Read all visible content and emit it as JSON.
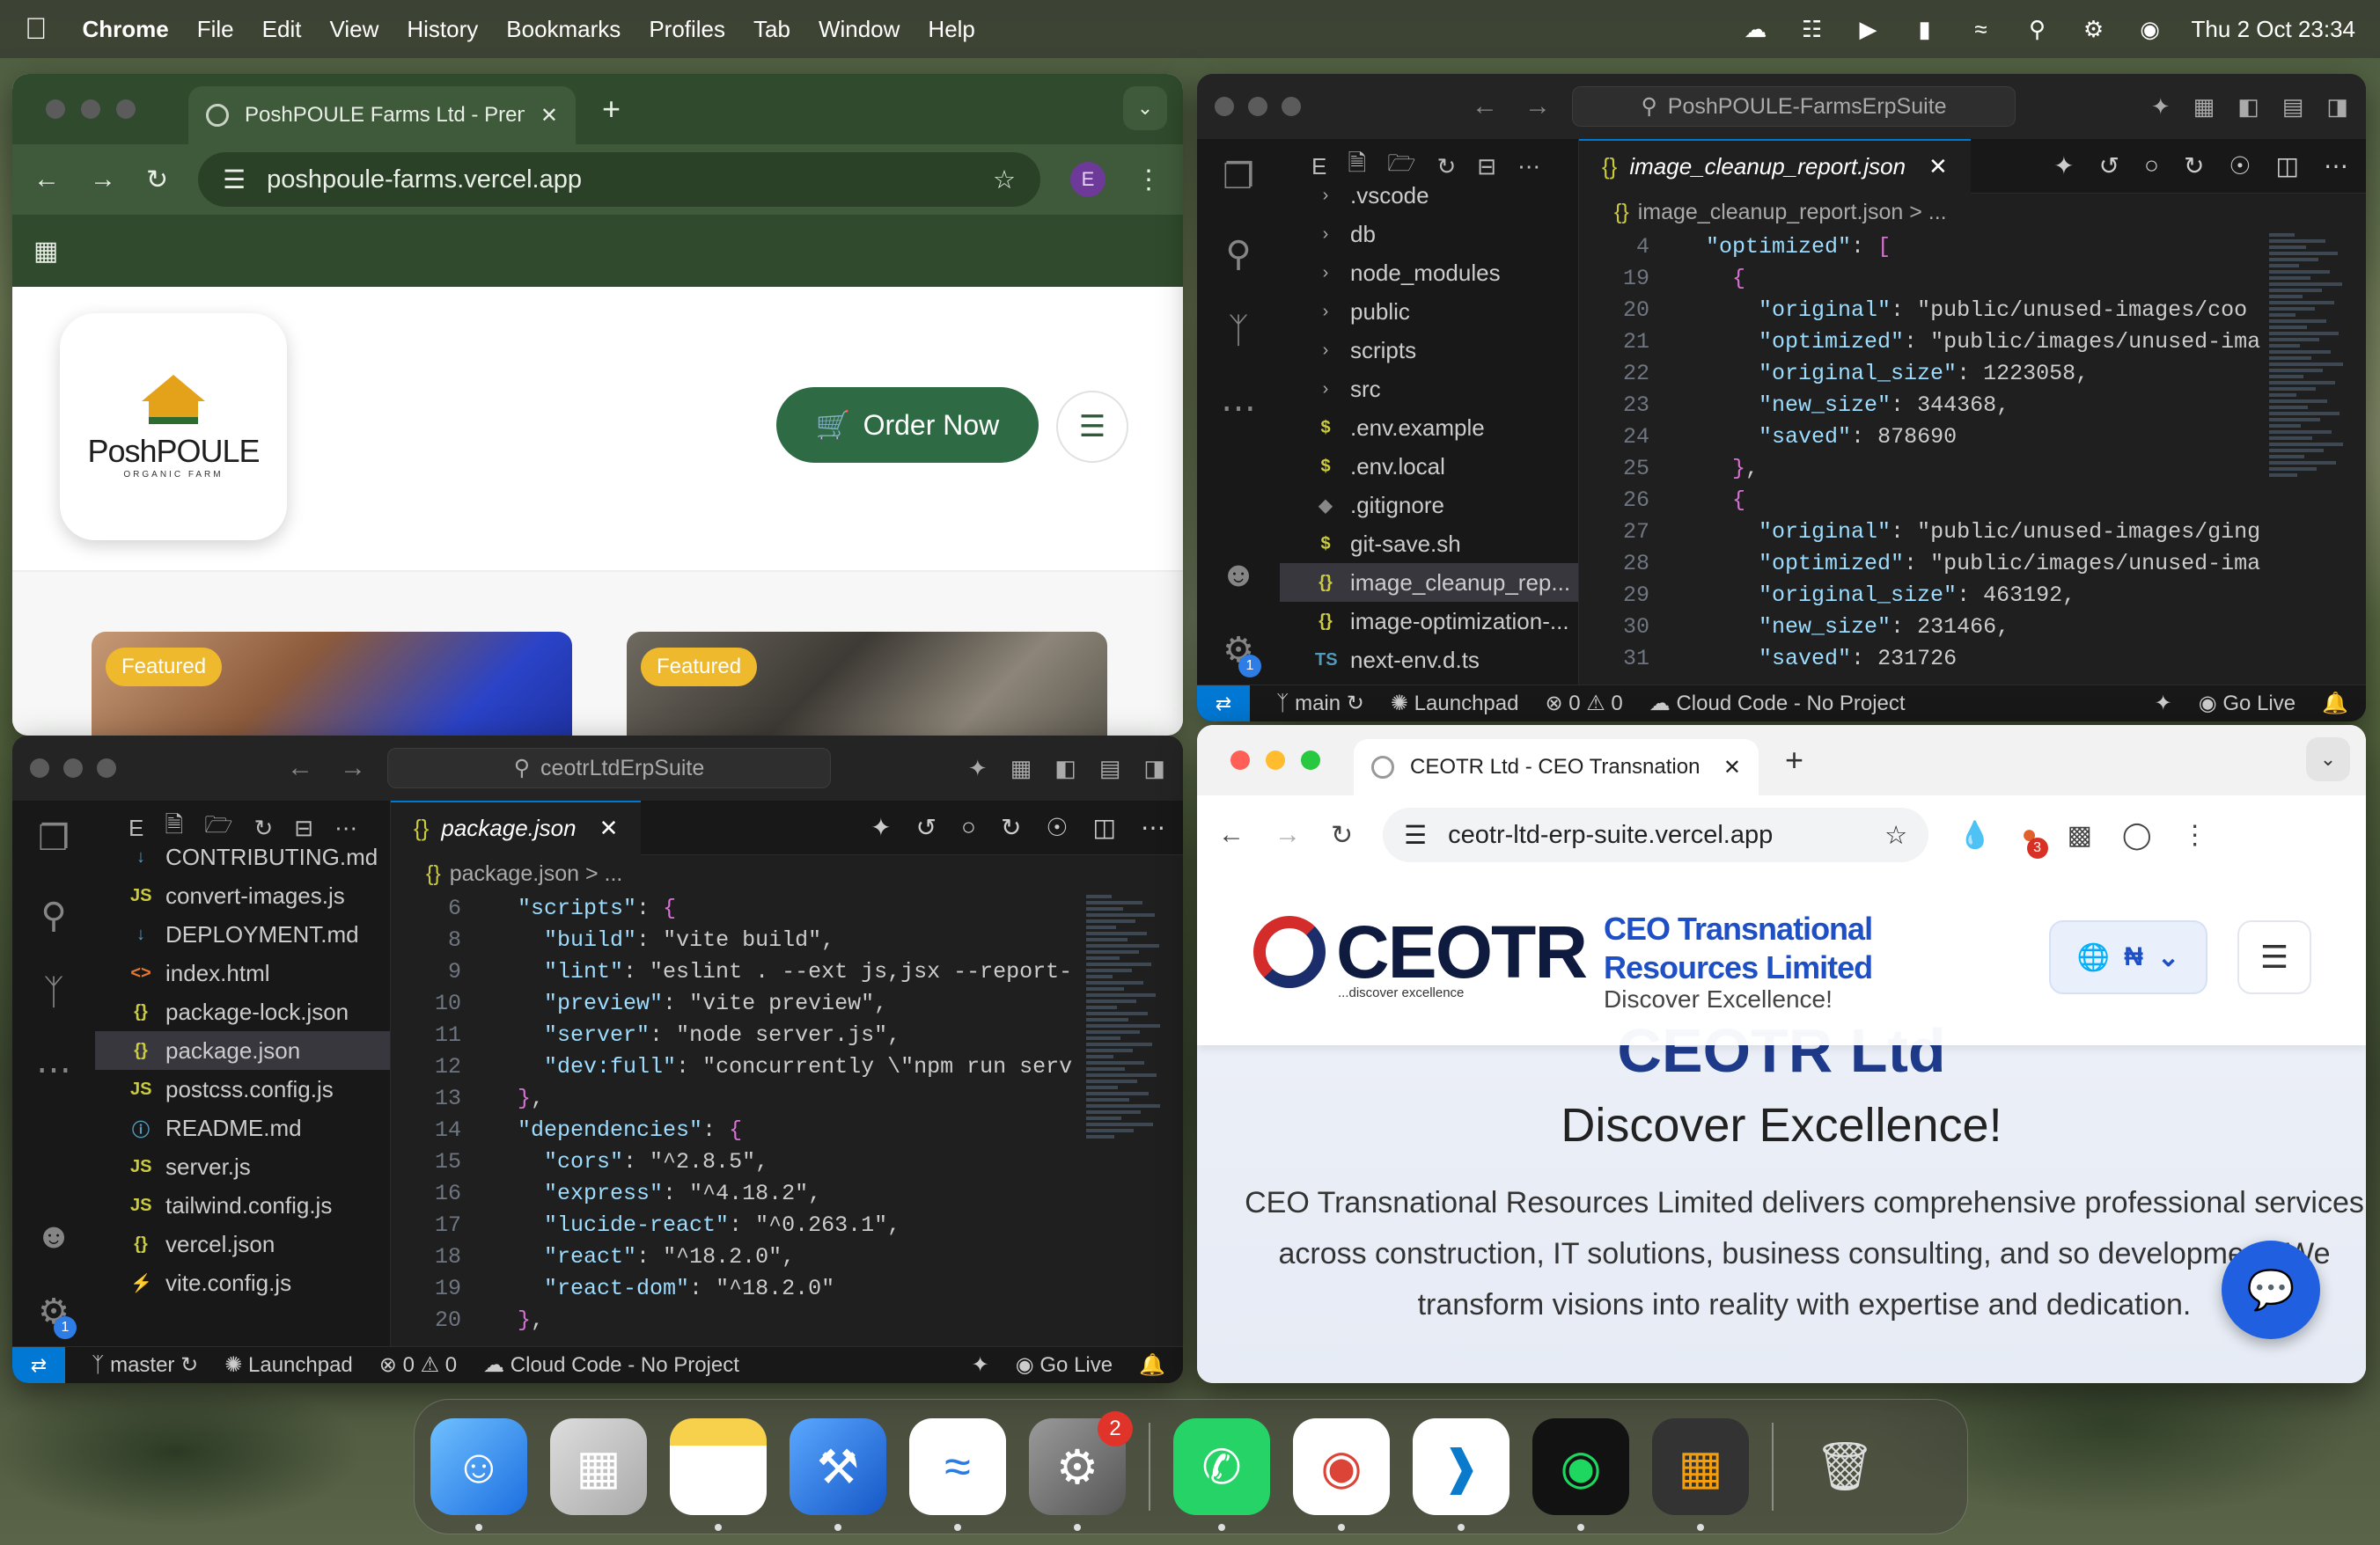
{
  "menubar": {
    "app": "Chrome",
    "items": [
      "File",
      "Edit",
      "View",
      "History",
      "Bookmarks",
      "Profiles",
      "Tab",
      "Window",
      "Help"
    ],
    "datetime": "Thu 2 Oct  23:34"
  },
  "browser1": {
    "tab_title": "PoshPOULE Farms Ltd - Prem",
    "url": "poshpoule-farms.vercel.app",
    "profile_initial": "E",
    "page": {
      "logo_name": "PoshPOULE",
      "logo_sub": "ORGANIC FARM",
      "order_button": "Order Now",
      "card_badges": [
        "Featured",
        "Featured"
      ]
    }
  },
  "vscode1": {
    "search": "PoshPOULE-FarmsErpSuite",
    "explorer_letter": "E",
    "files": [
      ".vscode",
      "db",
      "node_modules",
      "public",
      "scripts",
      "src",
      ".env.example",
      ".env.local",
      ".gitignore",
      "git-save.sh",
      "image_cleanup_rep...",
      "image-optimization-...",
      "next-env.d.ts"
    ],
    "tab": "image_cleanup_report.json",
    "breadcrumb": "image_cleanup_report.json > ...",
    "lines": [
      {
        "n": "4",
        "t": "  \"optimized\": ["
      },
      {
        "n": "19",
        "t": "    {"
      },
      {
        "n": "20",
        "t": "      \"original\": \"public/unused-images/coo"
      },
      {
        "n": "21",
        "t": "      \"optimized\": \"public/images/unused-ima"
      },
      {
        "n": "22",
        "t": "      \"original_size\": 1223058,"
      },
      {
        "n": "23",
        "t": "      \"new_size\": 344368,"
      },
      {
        "n": "24",
        "t": "      \"saved\": 878690"
      },
      {
        "n": "25",
        "t": "    },"
      },
      {
        "n": "26",
        "t": "    {"
      },
      {
        "n": "27",
        "t": "      \"original\": \"public/unused-images/ging"
      },
      {
        "n": "28",
        "t": "      \"optimized\": \"public/images/unused-ima"
      },
      {
        "n": "29",
        "t": "      \"original_size\": 463192,"
      },
      {
        "n": "30",
        "t": "      \"new_size\": 231466,"
      },
      {
        "n": "31",
        "t": "      \"saved\": 231726"
      }
    ],
    "status": {
      "branch": "main",
      "launchpad": "Launchpad",
      "problems": "0 ⚠ 0",
      "cloud": "Cloud Code - No Project",
      "golive": "Go Live"
    },
    "settings_badge": "1"
  },
  "vscode2": {
    "search": "ceotrLtdErpSuite",
    "explorer_letter": "E",
    "files": [
      "CONTRIBUTING.md",
      "convert-images.js",
      "DEPLOYMENT.md",
      "index.html",
      "package-lock.json",
      "package.json",
      "postcss.config.js",
      "README.md",
      "server.js",
      "tailwind.config.js",
      "vercel.json",
      "vite.config.js"
    ],
    "tab": "package.json",
    "breadcrumb": "package.json > ...",
    "lines": [
      {
        "n": "6",
        "t": "  \"scripts\": {"
      },
      {
        "n": "8",
        "t": "    \"build\": \"vite build\","
      },
      {
        "n": "9",
        "t": "    \"lint\": \"eslint . --ext js,jsx --report-"
      },
      {
        "n": "10",
        "t": "    \"preview\": \"vite preview\","
      },
      {
        "n": "11",
        "t": "    \"server\": \"node server.js\","
      },
      {
        "n": "12",
        "t": "    \"dev:full\": \"concurrently \\\"npm run serv"
      },
      {
        "n": "13",
        "t": "  },"
      },
      {
        "n": "14",
        "t": "  \"dependencies\": {"
      },
      {
        "n": "15",
        "t": "    \"cors\": \"^2.8.5\","
      },
      {
        "n": "16",
        "t": "    \"express\": \"^4.18.2\","
      },
      {
        "n": "17",
        "t": "    \"lucide-react\": \"^0.263.1\","
      },
      {
        "n": "18",
        "t": "    \"react\": \"^18.2.0\","
      },
      {
        "n": "19",
        "t": "    \"react-dom\": \"^18.2.0\""
      },
      {
        "n": "20",
        "t": "  },"
      }
    ],
    "status": {
      "branch": "master",
      "launchpad": "Launchpad",
      "problems": "0 ⚠ 0",
      "cloud": "Cloud Code - No Project",
      "golive": "Go Live"
    },
    "settings_badge": "1"
  },
  "browser2": {
    "tab_title": "CEOTR Ltd - CEO Transnation",
    "url": "ceotr-ltd-erp-suite.vercel.app",
    "ext_badge": "3",
    "page": {
      "logo_word": "CEOTR",
      "logo_tag": "...discover excellence",
      "company_line1": "CEO Transnational",
      "company_line2": "Resources Limited",
      "tagline": "Discover Excellence!",
      "lang_symbol": "₦",
      "hero_title": "CEOTR Ltd",
      "hero_sub": "Discover Excellence!",
      "hero_para": "CEO Transnational Resources Limited delivers comprehensive professional services across construction, IT solutions, business consulting, and so development. We transform visions into reality with expertise and dedication."
    }
  },
  "dock": {
    "settings_badge": "2"
  }
}
